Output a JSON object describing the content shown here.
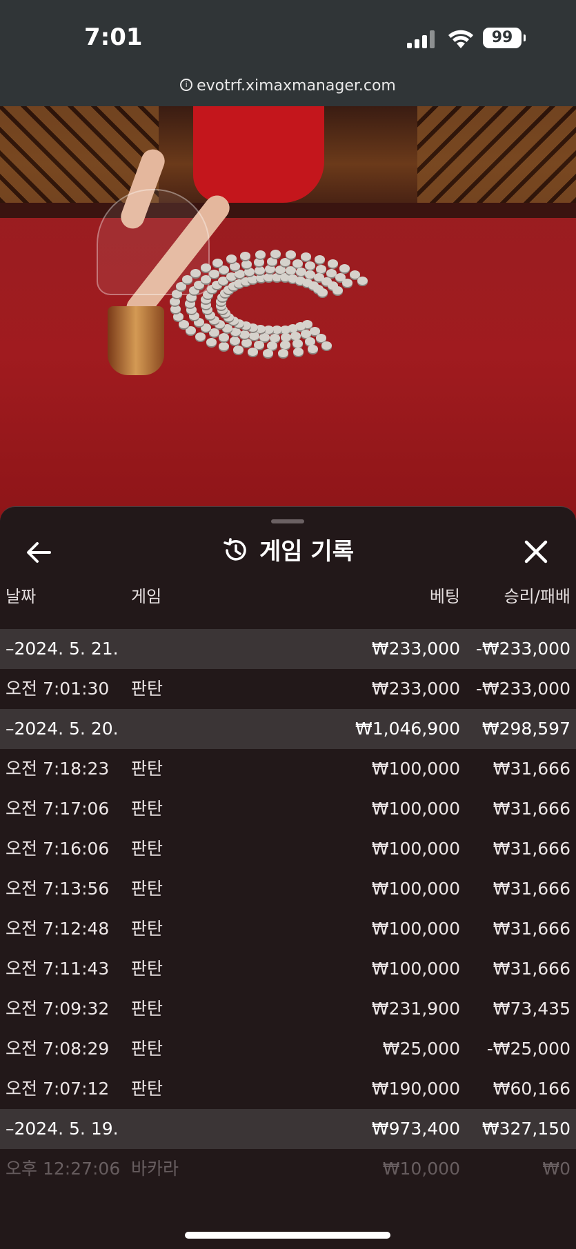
{
  "status_bar": {
    "time": "7:01",
    "battery": "99"
  },
  "browser": {
    "url": "evotrf.ximaxmanager.com"
  },
  "panel": {
    "title": "게임 기록",
    "columns": {
      "date": "날짜",
      "game": "게임",
      "bet": "베팅",
      "win_loss": "승리/패배"
    },
    "rows": [
      {
        "type": "group",
        "date": "–2024. 5. 21.",
        "game": "",
        "bet": "₩233,000",
        "win_loss": "-₩233,000"
      },
      {
        "type": "item",
        "date": "오전 7:01:30",
        "game": "판탄",
        "bet": "₩233,000",
        "win_loss": "-₩233,000"
      },
      {
        "type": "group",
        "date": "–2024. 5. 20.",
        "game": "",
        "bet": "₩1,046,900",
        "win_loss": "₩298,597"
      },
      {
        "type": "item",
        "date": "오전 7:18:23",
        "game": "판탄",
        "bet": "₩100,000",
        "win_loss": "₩31,666"
      },
      {
        "type": "item",
        "date": "오전 7:17:06",
        "game": "판탄",
        "bet": "₩100,000",
        "win_loss": "₩31,666"
      },
      {
        "type": "item",
        "date": "오전 7:16:06",
        "game": "판탄",
        "bet": "₩100,000",
        "win_loss": "₩31,666"
      },
      {
        "type": "item",
        "date": "오전 7:13:56",
        "game": "판탄",
        "bet": "₩100,000",
        "win_loss": "₩31,666"
      },
      {
        "type": "item",
        "date": "오전 7:12:48",
        "game": "판탄",
        "bet": "₩100,000",
        "win_loss": "₩31,666"
      },
      {
        "type": "item",
        "date": "오전 7:11:43",
        "game": "판탄",
        "bet": "₩100,000",
        "win_loss": "₩31,666"
      },
      {
        "type": "item",
        "date": "오전 7:09:32",
        "game": "판탄",
        "bet": "₩231,900",
        "win_loss": "₩73,435"
      },
      {
        "type": "item",
        "date": "오전 7:08:29",
        "game": "판탄",
        "bet": "₩25,000",
        "win_loss": "-₩25,000"
      },
      {
        "type": "item",
        "date": "오전 7:07:12",
        "game": "판탄",
        "bet": "₩190,000",
        "win_loss": "₩60,166"
      },
      {
        "type": "group",
        "date": "–2024. 5. 19.",
        "game": "",
        "bet": "₩973,400",
        "win_loss": "₩327,150"
      },
      {
        "type": "faded",
        "date": "오후 12:27:06",
        "game": "바카라",
        "bet": "₩10,000",
        "win_loss": "₩0"
      }
    ]
  },
  "icons": {
    "back": "arrow-left-icon",
    "close": "close-icon",
    "history": "history-icon",
    "secure": "info-icon"
  }
}
